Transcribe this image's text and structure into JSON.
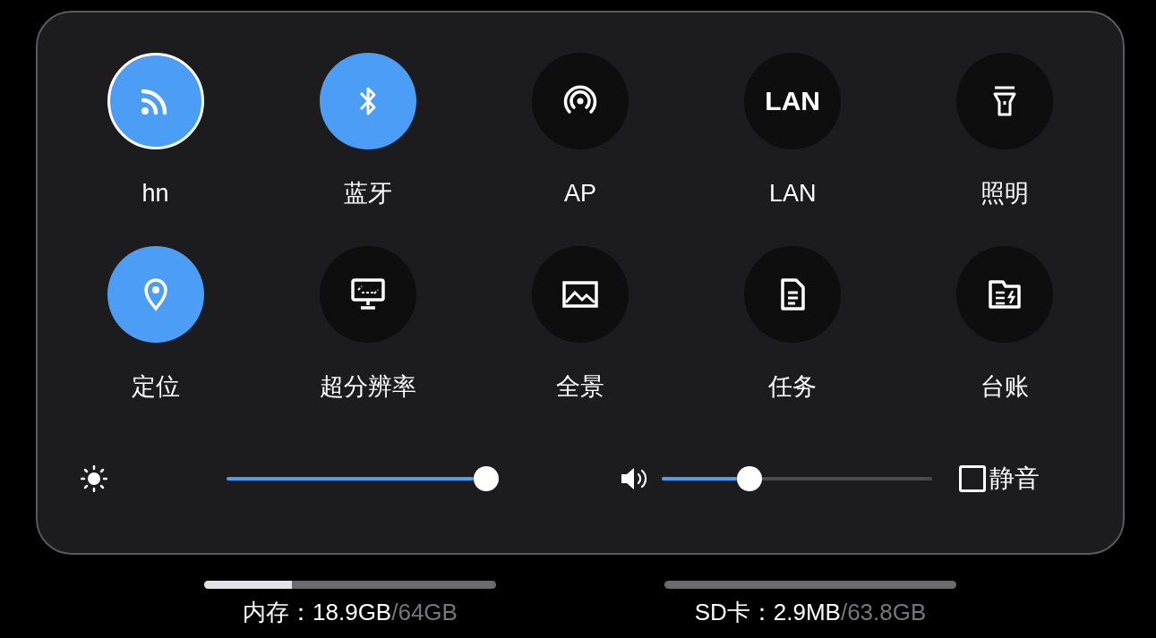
{
  "tiles": [
    {
      "label": "hn",
      "selected": true,
      "focused": true
    },
    {
      "label": "蓝牙",
      "selected": true,
      "focused": false
    },
    {
      "label": "AP",
      "selected": false,
      "focused": false
    },
    {
      "label": "LAN",
      "selected": false,
      "focused": false,
      "icon_text": "LAN"
    },
    {
      "label": "照明",
      "selected": false,
      "focused": false
    },
    {
      "label": "定位",
      "selected": true,
      "focused": false
    },
    {
      "label": "超分辨率",
      "selected": false,
      "focused": false
    },
    {
      "label": "全景",
      "selected": false,
      "focused": false
    },
    {
      "label": "任务",
      "selected": false,
      "focused": false
    },
    {
      "label": "台账",
      "selected": false,
      "focused": false
    }
  ],
  "brightness": {
    "level": 1.0
  },
  "volume": {
    "level": 0.29
  },
  "mute": {
    "label": "静音",
    "checked": false
  },
  "storage": [
    {
      "label": "内存：",
      "used": "18.9GB",
      "total": "/64GB",
      "level": 0.3
    },
    {
      "label": "SD卡：",
      "used": "2.9MB",
      "total": "/63.8GB",
      "level": 0.0
    }
  ]
}
